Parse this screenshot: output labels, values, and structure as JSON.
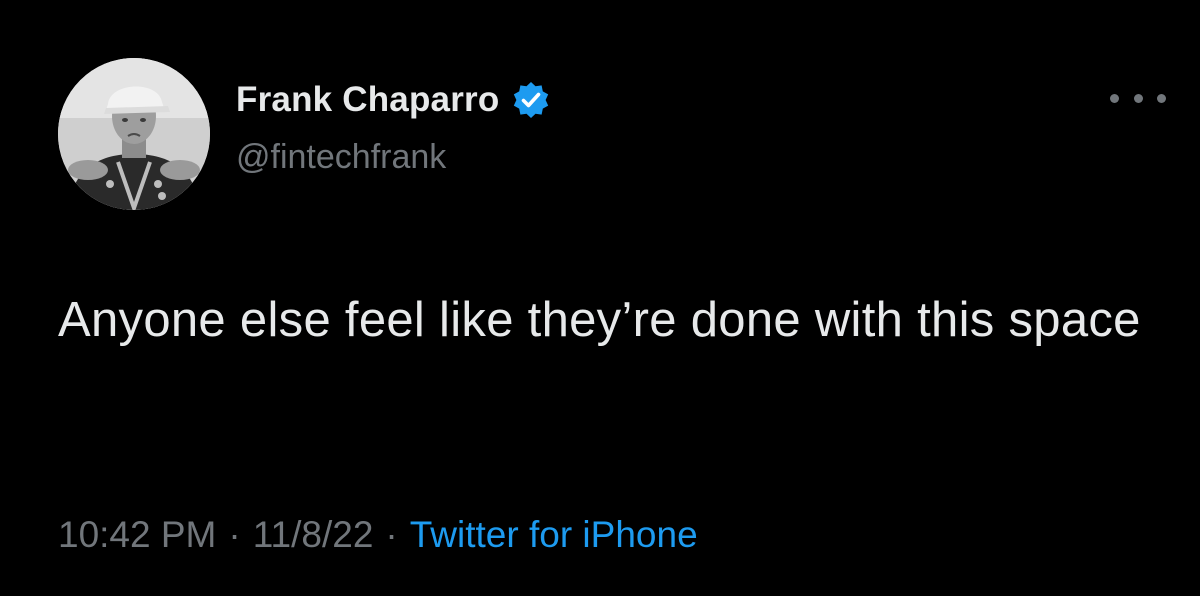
{
  "author": {
    "display_name": "Frank Chaparro",
    "handle": "@fintechfrank",
    "verified": true,
    "avatar_icon": "profile-photo-icon"
  },
  "tweet": {
    "text": "Anyone else feel like they’re done with this space",
    "time": "10:42 PM",
    "date": "11/8/22",
    "source": "Twitter for iPhone",
    "separator": "·"
  },
  "menu": {
    "icon": "more-options-icon"
  },
  "colors": {
    "background": "#000000",
    "primary_text": "#e7e9ea",
    "secondary_text": "#71767b",
    "accent": "#1d9bf0"
  }
}
